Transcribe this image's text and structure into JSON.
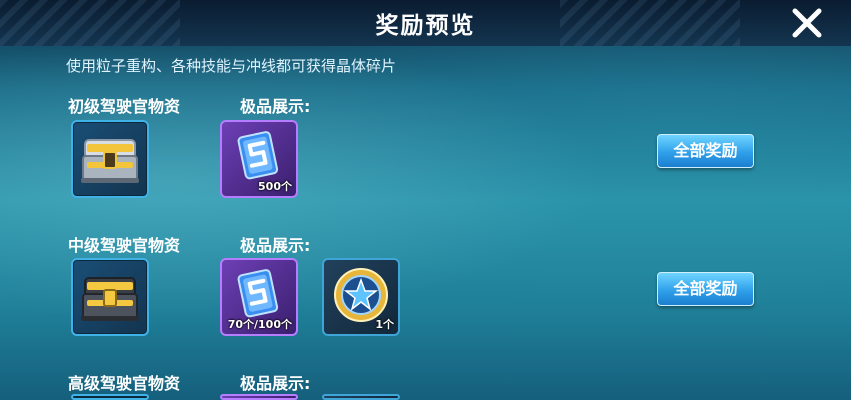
{
  "header": {
    "title": "奖励预览",
    "close_icon": "close-icon"
  },
  "subtitle": "使用粒子重构、各种技能与冲线都可获得晶体碎片",
  "tiers": [
    {
      "name": "初级驾驶官物资",
      "showcase_label": "极品展示:",
      "chest_icon": "silver-gold-chest-icon",
      "items": [
        {
          "icon": "crystal-card-icon",
          "quantity": "500个"
        }
      ],
      "button_label": "全部奖励"
    },
    {
      "name": "中级驾驶官物资",
      "showcase_label": "极品展示:",
      "chest_icon": "gold-black-chest-icon",
      "items": [
        {
          "icon": "crystal-card-icon",
          "quantity": "70个/100个"
        },
        {
          "icon": "star-medal-icon",
          "quantity": "1个"
        }
      ],
      "button_label": "全部奖励"
    },
    {
      "name": "高级驾驶官物资",
      "showcase_label": "极品展示:"
    }
  ],
  "colors": {
    "accent_button": "#2fa0ea",
    "epic_frame": "#b57dff",
    "rare_frame": "#3fb2e8"
  }
}
